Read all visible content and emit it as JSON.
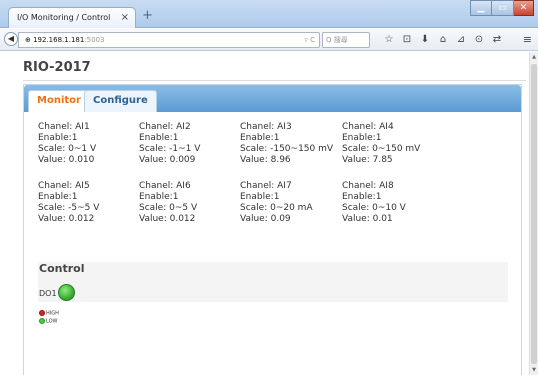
{
  "browser": {
    "tab_title": "I/O Monitoring / Control",
    "tab_close": "×",
    "new_tab": "+",
    "url_host": "192.168.1.181",
    "url_port": ":5003",
    "url_icons": "▿ C",
    "search_placeholder": "Q 搜尋",
    "toolbar_icons": [
      "☆",
      "⊡",
      "⬇",
      "⌂",
      "⊿",
      "⊙",
      "⇄"
    ],
    "menu": "≡",
    "back": "◀"
  },
  "page": {
    "title": "RIO-2017",
    "tabs": [
      {
        "label": "Monitor",
        "active": true
      },
      {
        "label": "Configure",
        "active": false
      }
    ]
  },
  "channels": [
    {
      "chanel": "Chanel: AI1",
      "enable": "Enable:1",
      "scale": "Scale:  0~1 V",
      "value": "Value:  0.010"
    },
    {
      "chanel": "Chanel: AI2",
      "enable": "Enable:1",
      "scale": "Scale:  -1~1 V",
      "value": "Value:  0.009"
    },
    {
      "chanel": "Chanel: AI3",
      "enable": "Enable:1",
      "scale": "Scale:  -150~150 mV",
      "value": "Value:  8.96"
    },
    {
      "chanel": "Chanel: AI4",
      "enable": "Enable:1",
      "scale": "Scale:  0~150 mV",
      "value": "Value:  7.85"
    },
    {
      "chanel": "Chanel: AI5",
      "enable": "Enable:1",
      "scale": "Scale:  -5~5 V",
      "value": "Value:  0.012"
    },
    {
      "chanel": "Chanel: AI6",
      "enable": "Enable:1",
      "scale": "Scale:  0~5 V",
      "value": "Value:  0.012"
    },
    {
      "chanel": "Chanel: AI7",
      "enable": "Enable:1",
      "scale": "Scale:  0~20 mA",
      "value": "Value:  0.09"
    },
    {
      "chanel": "Chanel: AI8",
      "enable": "Enable:1",
      "scale": "Scale:  0~10 V",
      "value": "Value:  0.01"
    }
  ],
  "control": {
    "title": "Control",
    "do_label": "DO1",
    "do_state_color": "#2fa42a",
    "legend_high": "HIGH",
    "legend_low": "LOW"
  },
  "colors": {
    "tab_active_text": "#e8731c",
    "tab_bar": "#5b9bd3",
    "high": "#dd2222",
    "low": "#44cc44"
  }
}
